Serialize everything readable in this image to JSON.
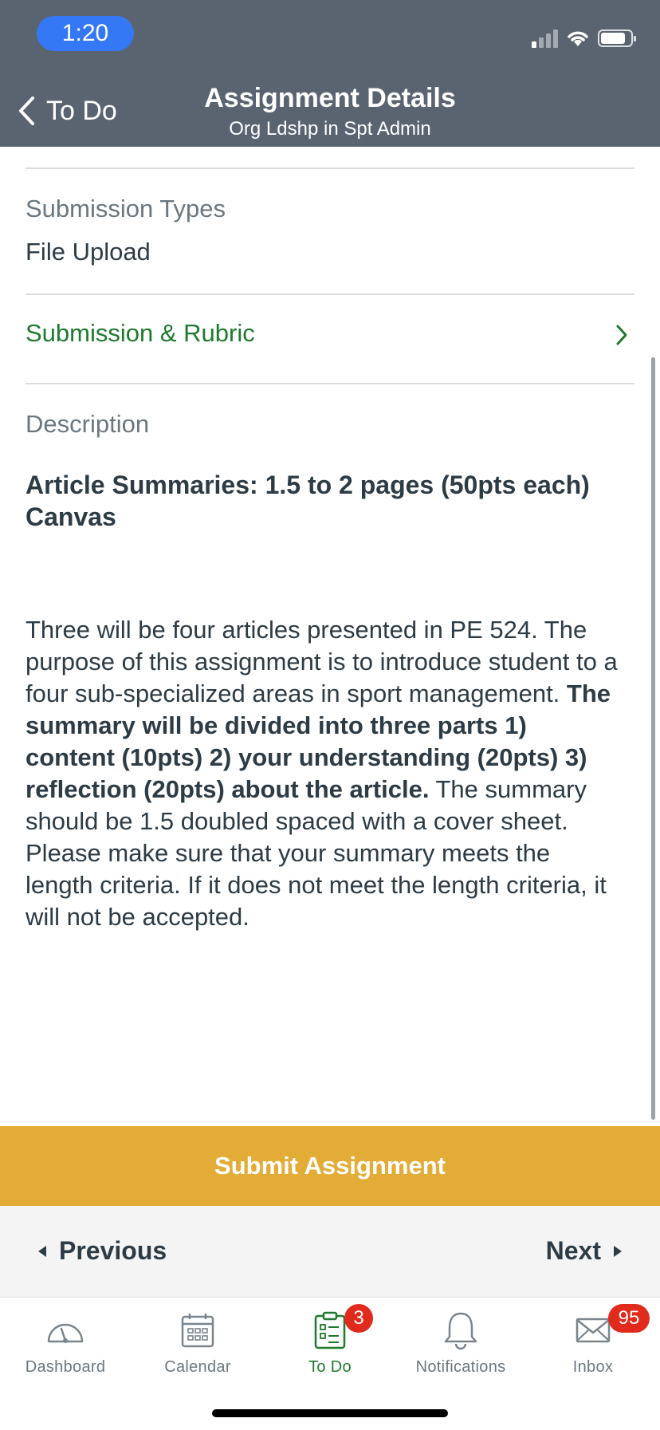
{
  "status_bar": {
    "time": "1:20"
  },
  "nav": {
    "back_label": "To Do",
    "title": "Assignment Details",
    "subtitle": "Org Ldshp in Spt Admin"
  },
  "submission_types": {
    "label": "Submission Types",
    "value": "File Upload"
  },
  "rubric": {
    "label": "Submission & Rubric"
  },
  "description": {
    "label": "Description",
    "title": "Article Summaries: 1.5 to 2 pages (50pts each) Canvas",
    "body_part1": "Three will be four articles presented in PE 524. The purpose of this assignment is to introduce student to a four sub-specialized areas in sport management. ",
    "body_bold": "The summary will be divided into three parts 1) content (10pts) 2) your understanding (20pts) 3) reflection (20pts) about the article.",
    "body_part2": " The summary should be 1.5 doubled spaced with a cover sheet. Please make sure that your summary meets the length criteria. If it does not meet the length criteria, it will not be accepted."
  },
  "submit_button": "Submit Assignment",
  "pager": {
    "previous": "Previous",
    "next": "Next"
  },
  "tabs": [
    {
      "label": "Dashboard",
      "icon": "dashboard-icon"
    },
    {
      "label": "Calendar",
      "icon": "calendar-icon"
    },
    {
      "label": "To Do",
      "icon": "todo-icon",
      "badge": "3",
      "active": true
    },
    {
      "label": "Notifications",
      "icon": "bell-icon"
    },
    {
      "label": "Inbox",
      "icon": "mail-icon",
      "badge": "95"
    }
  ],
  "colors": {
    "header": "#5a6470",
    "accent_green": "#1f7a2e",
    "submit": "#e3ac36",
    "badge": "#e02a1b",
    "time_pill": "#3478f6"
  }
}
